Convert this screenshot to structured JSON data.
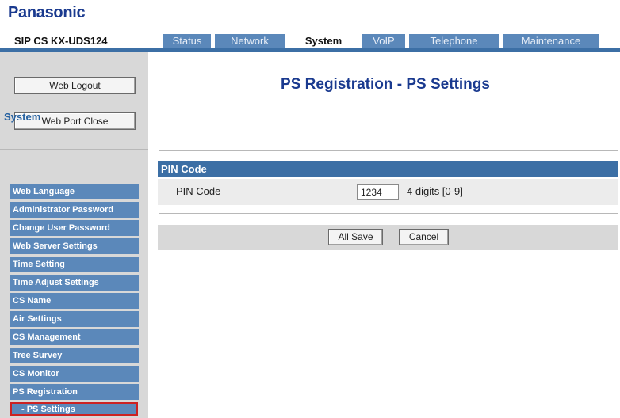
{
  "header": {
    "brand": "Panasonic",
    "model": "SIP CS KX-UDS124"
  },
  "tabs": [
    {
      "label": "Status",
      "active": false
    },
    {
      "label": "Network",
      "active": false
    },
    {
      "label": "System",
      "active": true
    },
    {
      "label": "VoIP",
      "active": false
    },
    {
      "label": "Telephone",
      "active": false
    },
    {
      "label": "Maintenance",
      "active": false
    }
  ],
  "sidebar": {
    "logout_label": "Web Logout",
    "port_close_label": "Web Port Close",
    "section_title": "System",
    "items": [
      {
        "label": "Web Language"
      },
      {
        "label": "Administrator Password"
      },
      {
        "label": "Change User Password"
      },
      {
        "label": "Web Server Settings"
      },
      {
        "label": "Time Setting"
      },
      {
        "label": "Time Adjust Settings"
      },
      {
        "label": "CS Name"
      },
      {
        "label": "Air Settings"
      },
      {
        "label": "CS Management"
      },
      {
        "label": "Tree Survey"
      },
      {
        "label": "CS Monitor"
      },
      {
        "label": "PS Registration"
      }
    ],
    "sub_item": {
      "label": "- PS Settings",
      "selected": true
    }
  },
  "main": {
    "title": "PS Registration - PS Settings",
    "section_title": "PIN Code",
    "pin_label": "PIN Code",
    "pin_value": "1234",
    "pin_hint": "4 digits [0-9]",
    "save_label": "All Save",
    "cancel_label": "Cancel"
  },
  "colors": {
    "brand": "#1a3a8f",
    "tab_bar": "#3c6fa5",
    "menu_item": "#5b88ba",
    "selected_outline": "#cc2222"
  }
}
